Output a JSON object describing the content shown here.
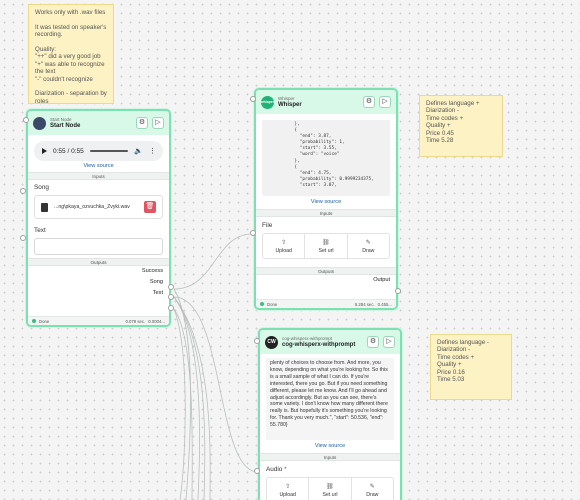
{
  "notes": {
    "left": "Works only with .wav files\n\nIt was tested on speaker's recording.\n\nQuality:\n\"++\" did a very good job\n\"+\" was able to recognize the text\n\"-\" couldn't recognize\n\nDiarization - separation by roles\n\nThe price is indicated in tokens for each node.",
    "whisper": "Defines language +\nDiarization -\nTime codes +\nQuality +\nPrice 0.45\nTime 5.28",
    "cog": "Defines language -\nDiarization -\nTime codes +\nQuality +\nPrice 0.16\nTime 5.03"
  },
  "start_node": {
    "sub": "Start Node",
    "title": "Start Node",
    "audio_time": "0:55 / 0:55",
    "view_source": "View source",
    "inputs_label": "Inputs",
    "song_label": "Song",
    "file_name": "...ng\\pkaya_ozvuchka_Zvyki.wav",
    "text_label": "Text",
    "outputs_label": "Outputs",
    "outputs": [
      "Success",
      "Song",
      "Text"
    ],
    "status": "Done",
    "time": "0.078 sec.",
    "cost": "0.0004..."
  },
  "whisper_node": {
    "sub": "Whisper",
    "title": "Whisper",
    "icon_text": "whisper",
    "code": "          },\n          {\n            \"end\": 3.87,\n            \"probability\": 1,\n            \"start\": 3.55,\n            \"word\": \"voice\"\n          },\n          {\n            \"end\": 4.75,\n            \"probability\": 0.9999234375,\n            \"start\": 3.87,",
    "view_source": "View source",
    "inputs_label": "Inputs",
    "file_label": "File",
    "upload": "Upload",
    "set_url": "Set url",
    "draw": "Draw",
    "outputs_label": "Outputs",
    "output": "Output",
    "status": "Done",
    "time": "5.284 sec.",
    "cost": "0.455..."
  },
  "cog_node": {
    "sub": "cog-whisperx-withprompt",
    "title": "cog-whisperx-withprompt",
    "icon_text": "CW",
    "text": "plenty of choices to choose from. And more, you know, depending on what you're looking for. So this is a small sample of what I can do. If you're interested, there you go. But if you need something different, please let me know. And I'll go ahead and adjust accordingly. But as you can see, there's some variety. I don't know how many different there really is. But hopefully it's something you're looking for. Thank you very much.\", \"start\": 50.536, \"end\": 55.780}",
    "view_source": "View source",
    "inputs_label": "Inputs",
    "audio_label": "Audio",
    "upload": "Upload",
    "set_url": "Set url",
    "draw": "Draw"
  }
}
